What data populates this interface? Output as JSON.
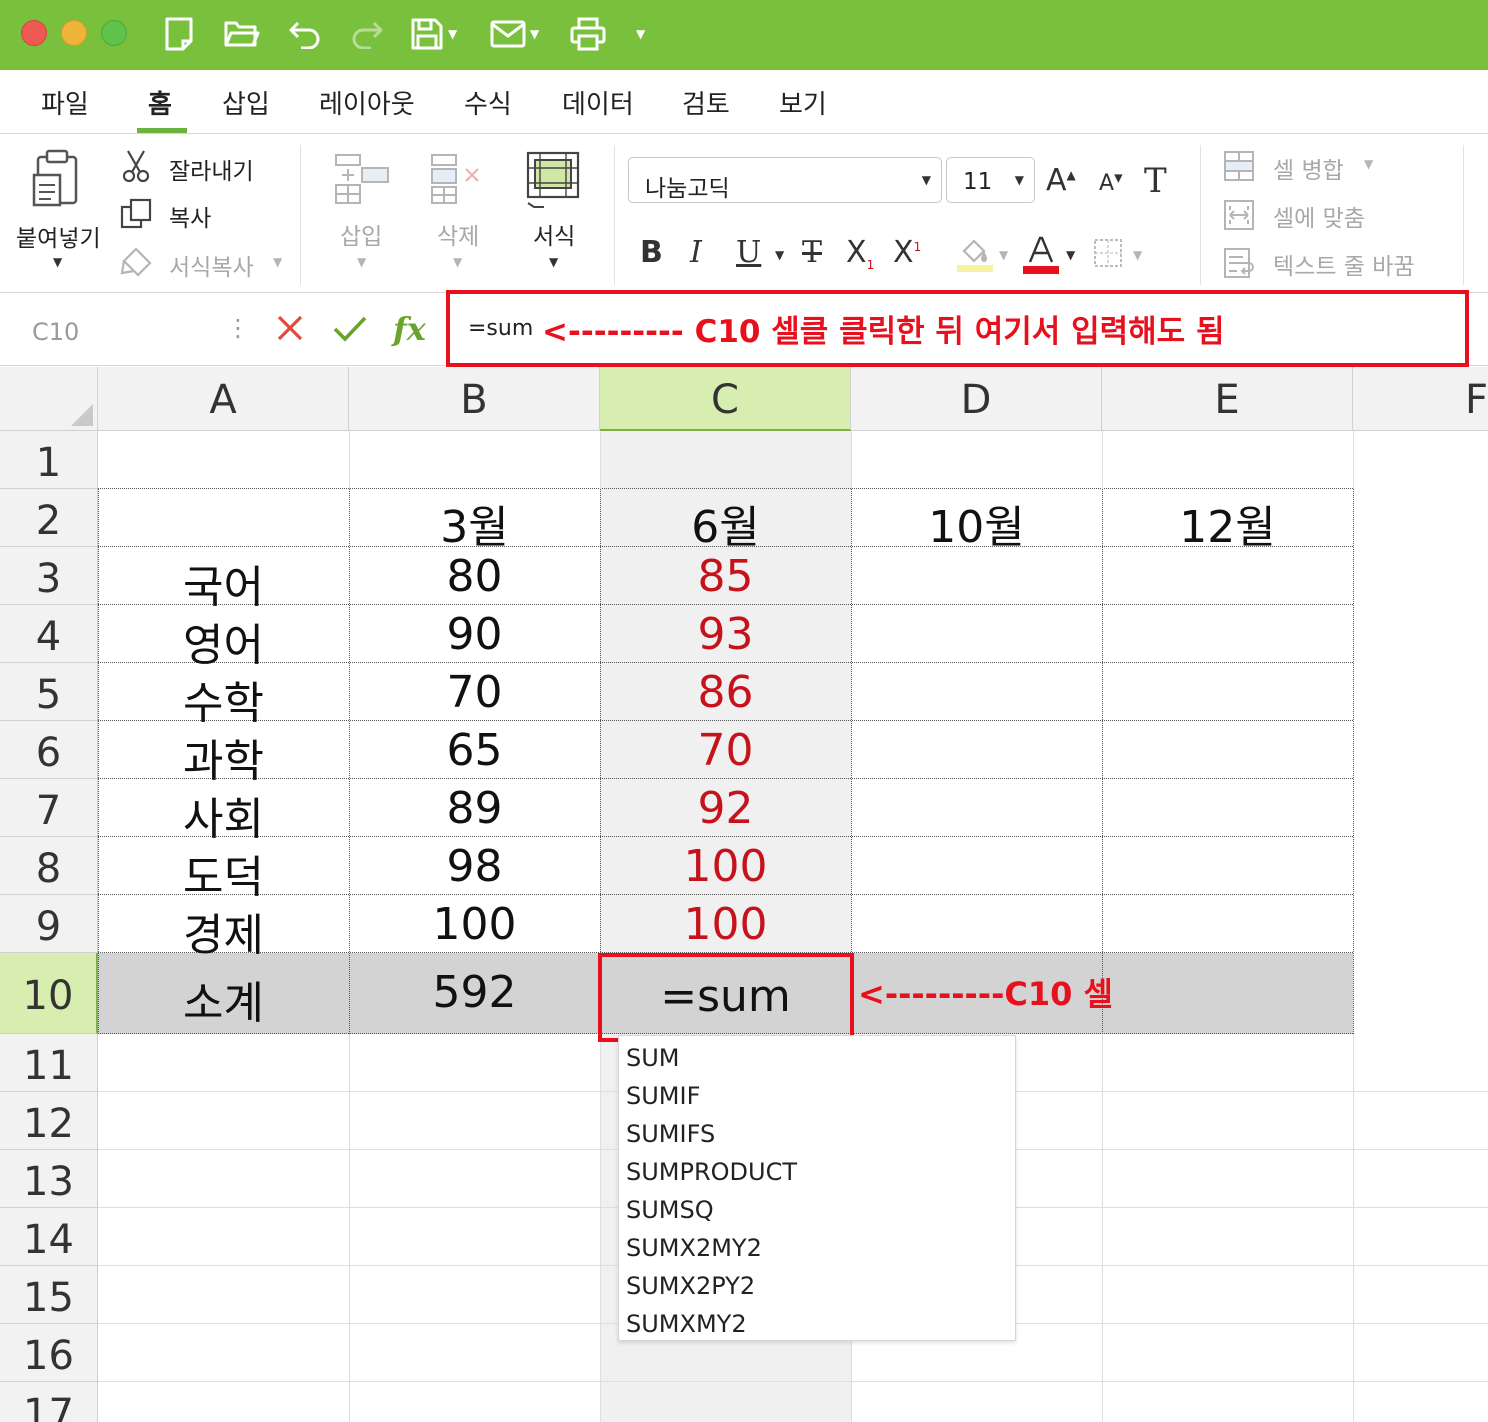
{
  "titlebar": {
    "icons": [
      "new-document-icon",
      "open-folder-icon",
      "undo-icon",
      "redo-icon",
      "save-icon",
      "mail-icon",
      "print-icon",
      "customize-caret-icon"
    ]
  },
  "tabs": [
    {
      "label": "파일"
    },
    {
      "label": "홈",
      "active": true
    },
    {
      "label": "삽입"
    },
    {
      "label": "레이아웃"
    },
    {
      "label": "수식"
    },
    {
      "label": "데이터"
    },
    {
      "label": "검토"
    },
    {
      "label": "보기"
    }
  ],
  "ribbon": {
    "paste_label": "붙여넣기",
    "cut_label": "잘라내기",
    "copy_label": "복사",
    "format_painter_label": "서식복사",
    "insert_label": "삽입",
    "delete_label": "삭제",
    "format_label": "서식",
    "font_name": "나눔고딕",
    "font_size": "11",
    "merge_label": "셀 병합",
    "fit_label": "셀에 맞춤",
    "wrap_label": "텍스트 줄 바꿈",
    "font_color": "#e8101d",
    "highlight_color": "#f7f3a0"
  },
  "formula_bar": {
    "name_box": "C10",
    "fx_label": "fx",
    "content": "=sum",
    "annotation": "<--------- C10 셀클 클릭한 뒤 여기서 입력해도 됨"
  },
  "sheet": {
    "columns": [
      "A",
      "B",
      "C",
      "D",
      "E",
      "F"
    ],
    "selected_column": "C",
    "rows": [
      "1",
      "2",
      "3",
      "4",
      "5",
      "6",
      "7",
      "8",
      "9",
      "10",
      "11",
      "12",
      "13",
      "14",
      "15",
      "16",
      "17"
    ],
    "selected_row": "10",
    "header_row": [
      "",
      "3월",
      "6월",
      "10월",
      "12월"
    ],
    "data": [
      {
        "subject": "국어",
        "b": "80",
        "c": "85"
      },
      {
        "subject": "영어",
        "b": "90",
        "c": "93"
      },
      {
        "subject": "수학",
        "b": "70",
        "c": "86"
      },
      {
        "subject": "과학",
        "b": "65",
        "c": "70"
      },
      {
        "subject": "사회",
        "b": "89",
        "c": "92"
      },
      {
        "subject": "도덕",
        "b": "98",
        "c": "100"
      },
      {
        "subject": "경제",
        "b": "100",
        "c": "100"
      }
    ],
    "total": {
      "label": "소계",
      "b": "592",
      "c": "=sum"
    },
    "c10_annotation": "<---------C10 셀",
    "accent_color": "#e8101d"
  },
  "autocomplete": [
    "SUM",
    "SUMIF",
    "SUMIFS",
    "SUMPRODUCT",
    "SUMSQ",
    "SUMX2MY2",
    "SUMX2PY2",
    "SUMXMY2"
  ]
}
